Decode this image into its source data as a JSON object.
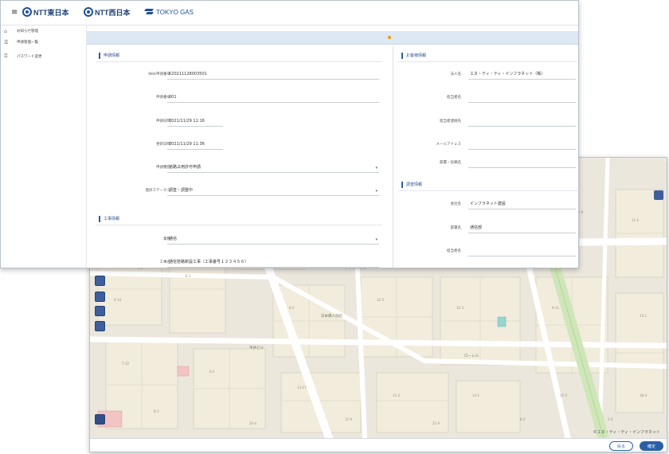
{
  "header": {
    "brands": [
      "NTT東日本",
      "NTT西日本",
      "TOKYO GAS"
    ]
  },
  "sidebar": {
    "items": [
      {
        "label": "お知らせ管理",
        "icon": "home-icon"
      },
      {
        "label": "申請管理一覧",
        "icon": "list-icon"
      },
      {
        "label": "パスワード変更",
        "icon": "lock-icon"
      }
    ]
  },
  "application_info": {
    "title": "申請情報",
    "fields": [
      {
        "label": "Web申請番号",
        "value": "K20211128003501"
      },
      {
        "label": "申請番号",
        "value": "001"
      },
      {
        "label": "申請日時",
        "value": "2021/11/29 11:16"
      },
      {
        "label": "更新日時",
        "value": "2021/11/29 11:36"
      },
      {
        "label": "申請種別",
        "value": "道路占用許可申請"
      },
      {
        "label": "進捗ステータス",
        "value": "調査・調整中"
      }
    ]
  },
  "construction_info": {
    "title": "工事情報",
    "fields": [
      {
        "label": "業種",
        "value": "通信"
      },
      {
        "label": "工事名",
        "value": "通信管路新設工事（工事番号１２３４５６）"
      }
    ]
  },
  "customer_info": {
    "title": "お客様情報",
    "fields": [
      {
        "label": "法人名",
        "value": "エヌ・ティ・ティ・インフラネット（株）"
      },
      {
        "label": "担当者名",
        "value": ""
      },
      {
        "label": "担当者連絡先",
        "value": ""
      },
      {
        "label": "メールアドレス",
        "value": ""
      },
      {
        "label": "部署・役職名",
        "value": ""
      }
    ]
  },
  "survey_info": {
    "title": "調査情報",
    "fields": [
      {
        "label": "会社名",
        "value": "インフラネット建設"
      },
      {
        "label": "部署名",
        "value": "通信部"
      },
      {
        "label": "担当者名",
        "value": ""
      }
    ]
  },
  "map": {
    "credit": "©エヌ・ティ・ティ・インフラネット",
    "buttons": {
      "back": "戻る",
      "confirm": "確定"
    }
  },
  "colors": {
    "accent": "#2a5fa8",
    "header_bar": "#dde8f4",
    "map_background": "#ebe7dd",
    "map_road": "#ffffff",
    "map_rail": "#cfe6b8"
  }
}
